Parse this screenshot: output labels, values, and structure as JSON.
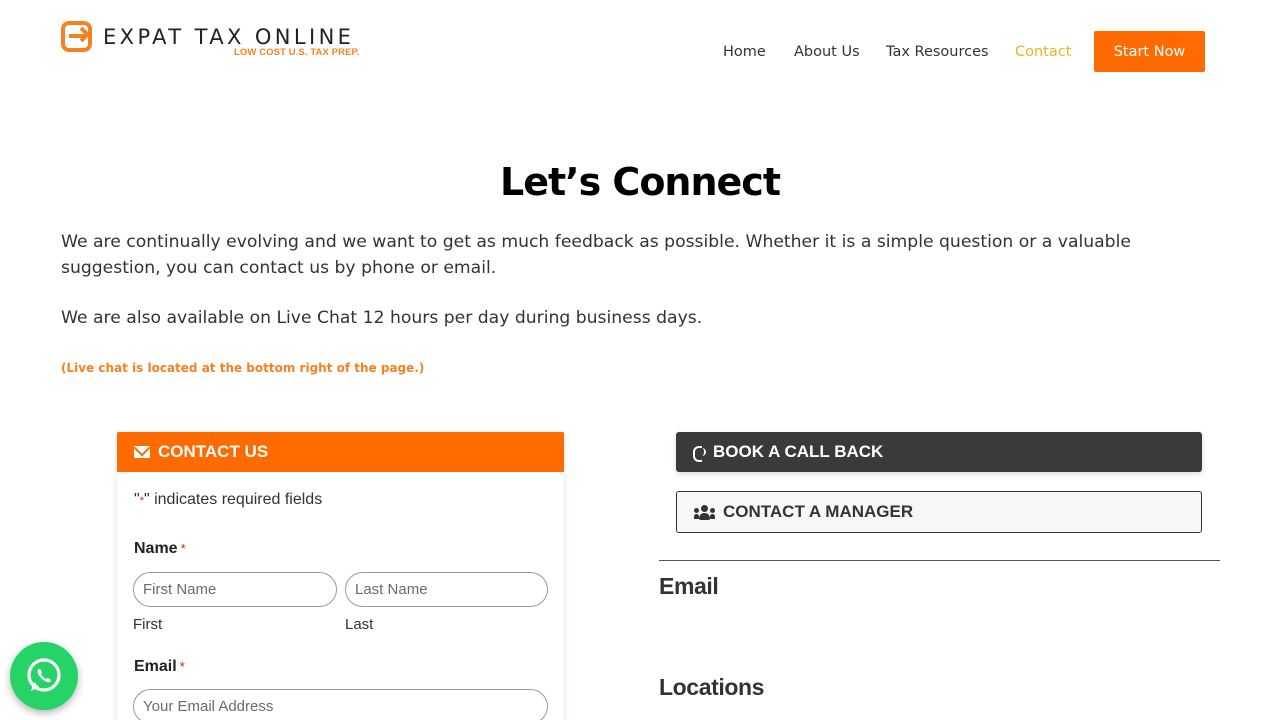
{
  "brand": {
    "name": "EXPAT TAX ONLINE",
    "tagline": "LOW COST U.S. TAX PREP.",
    "accent_color": "#f58220",
    "cta_color": "#ff6b00"
  },
  "nav": {
    "items": [
      {
        "label": "Home"
      },
      {
        "label": "About Us"
      },
      {
        "label": "Tax Resources"
      },
      {
        "label": "Contact"
      }
    ],
    "active": "Contact",
    "cta_label": "Start Now"
  },
  "hero": {
    "title": "Let’s Connect",
    "para1": "We are continually evolving and we want to get as much feedback as possible. Whether it is a simple question or a valuable suggestion, you can contact us by phone or email.",
    "para2": "We are also available on Live Chat 12 hours per day during business days.",
    "note": "(Live chat is located at the bottom right of the page.)"
  },
  "contact_form": {
    "header": "CONTACT US",
    "required_note_prefix": "\"",
    "required_star": "*",
    "required_note_suffix": "\" indicates required fields",
    "name_label": "Name",
    "name_star": "*",
    "first_placeholder": "First Name",
    "last_placeholder": "Last Name",
    "first_sublabel": "First",
    "last_sublabel": "Last",
    "email_label": "Email",
    "email_star": "*",
    "email_placeholder": "Your Email Address"
  },
  "side": {
    "callback_label": "BOOK A CALL BACK",
    "manager_label": "CONTACT A MANAGER",
    "email_heading": "Email",
    "locations_heading": "Locations"
  },
  "icons": {
    "logo": "logo-arrow-icon",
    "mail": "envelope-icon",
    "phone": "phone-volume-icon",
    "people": "users-icon",
    "whatsapp": "whatsapp-icon"
  }
}
